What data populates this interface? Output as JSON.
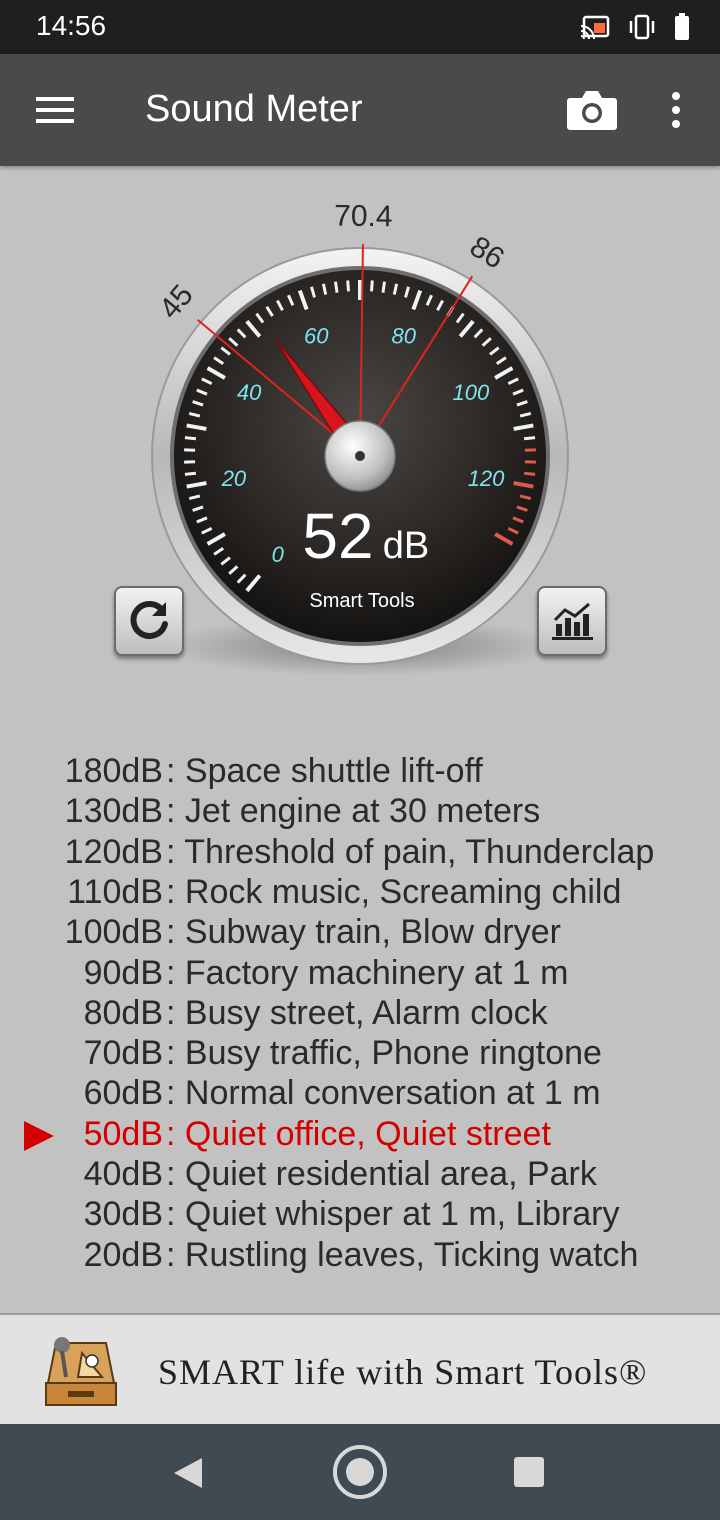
{
  "status_bar": {
    "time": "14:56"
  },
  "app_bar": {
    "title": "Sound Meter"
  },
  "gauge": {
    "reading_value": "52",
    "reading_unit": "dB",
    "brand": "Smart Tools",
    "current_db": 52,
    "scale_labels": [
      "0",
      "20",
      "40",
      "60",
      "80",
      "100",
      "120"
    ],
    "markers": [
      {
        "label": "45",
        "db": 45
      },
      {
        "label": "70.4",
        "db": 70.4
      },
      {
        "label": "86",
        "db": 86
      }
    ]
  },
  "reference_list": [
    {
      "db": "180dB",
      "desc": ": Space shuttle lift-off",
      "active": false
    },
    {
      "db": "130dB",
      "desc": ": Jet engine at 30 meters",
      "active": false
    },
    {
      "db": "120dB",
      "desc": ": Threshold of pain, Thunderclap",
      "active": false
    },
    {
      "db": "110dB",
      "desc": ": Rock music, Screaming child",
      "active": false
    },
    {
      "db": "100dB",
      "desc": ": Subway train, Blow dryer",
      "active": false
    },
    {
      "db": "90dB",
      "desc": ": Factory machinery at 1 m",
      "active": false
    },
    {
      "db": "80dB",
      "desc": ": Busy street, Alarm clock",
      "active": false
    },
    {
      "db": "70dB",
      "desc": ": Busy traffic, Phone ringtone",
      "active": false
    },
    {
      "db": "60dB",
      "desc": ": Normal conversation at 1 m",
      "active": false
    },
    {
      "db": "50dB",
      "desc": ": Quiet office, Quiet street",
      "active": true
    },
    {
      "db": "40dB",
      "desc": ": Quiet residential area, Park",
      "active": false
    },
    {
      "db": "30dB",
      "desc": ": Quiet whisper at 1 m, Library",
      "active": false
    },
    {
      "db": "20dB",
      "desc": ": Rustling leaves, Ticking watch",
      "active": false
    }
  ],
  "banner": {
    "slogan": "SMART life with Smart Tools®"
  },
  "colors": {
    "accent_red": "#d40000",
    "scale_cyan": "#7fe3ee",
    "app_bar": "#4a4a4a"
  }
}
